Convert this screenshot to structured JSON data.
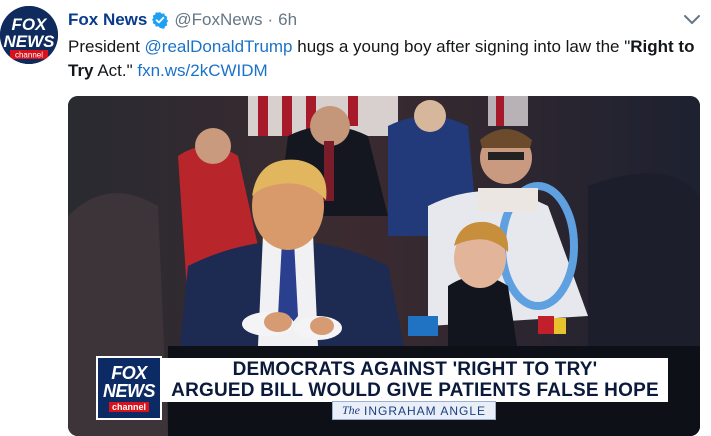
{
  "tweet": {
    "account_name": "Fox News",
    "handle": "@FoxNews",
    "separator": "·",
    "time": "6h",
    "text_prefix": "President ",
    "mention": "@realDonaldTrump",
    "text_middle": " hugs a young boy after signing into law the \"",
    "bold": "Right to Try",
    "text_suffix": " Act.\" ",
    "link": "fxn.ws/2kCWIDM"
  },
  "avatar": {
    "line1": "FOX",
    "line2": "NEWS",
    "line3": "channel"
  },
  "video": {
    "logo_line1": "FOX",
    "logo_line2": "NEWS",
    "logo_line3": "channel",
    "chyron_line1": "DEMOCRATS AGAINST 'RIGHT TO TRY'",
    "chyron_line2": "ARGUED BILL WOULD GIVE PATIENTS FALSE HOPE",
    "show_the": "The",
    "show_name": "INGRAHAM ANGLE"
  },
  "icons": {
    "verified": "verified-badge-icon",
    "menu": "chevron-down-icon"
  },
  "colors": {
    "name": "#0a3a8c",
    "link": "#1b73c8",
    "verified": "#1da1f2",
    "chyron_text": "#0b1a3a",
    "logo_bg": "#0c2a63",
    "logo_red": "#d8111b"
  }
}
